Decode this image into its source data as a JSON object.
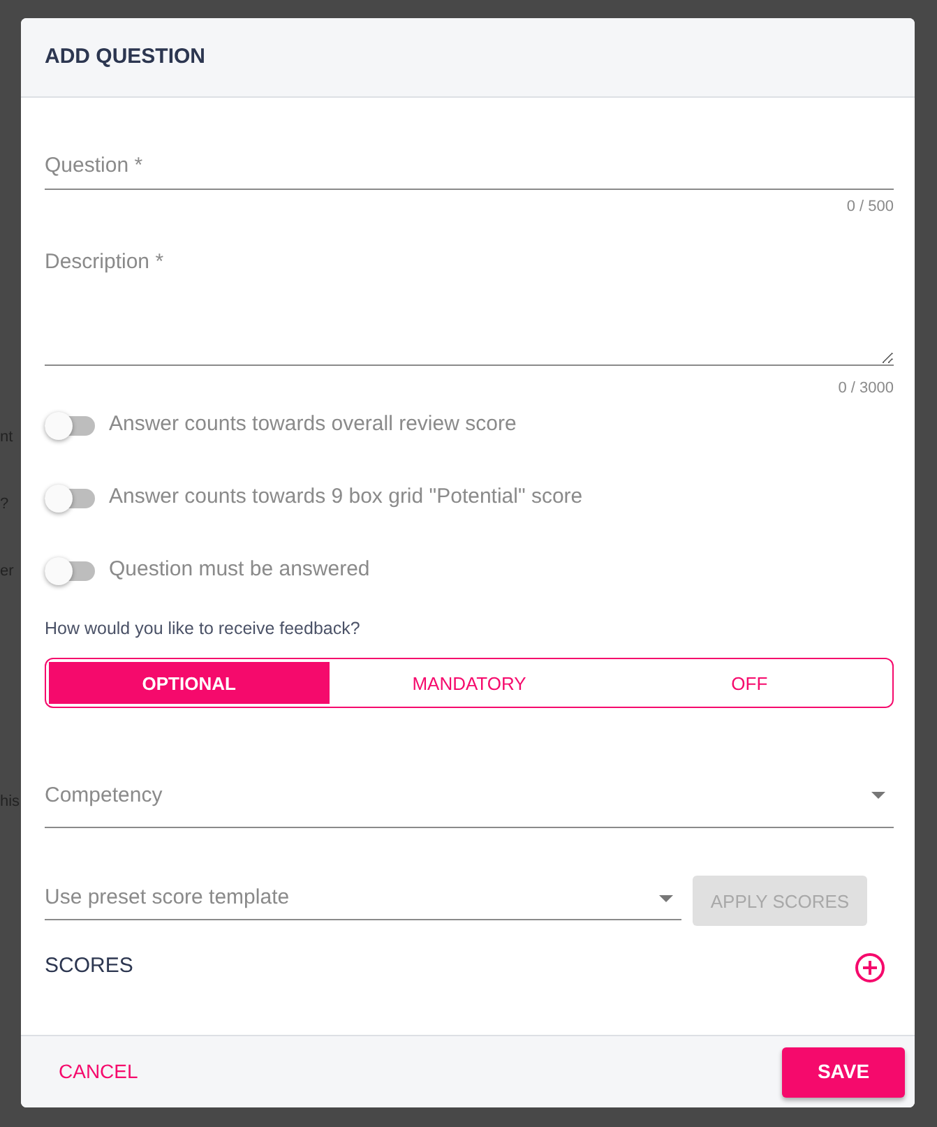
{
  "background": {
    "fragments": [
      "nt",
      "?",
      "er",
      "his"
    ]
  },
  "dialog": {
    "title": "ADD QUESTION",
    "question": {
      "placeholder": "Question *",
      "counter": "0 / 500"
    },
    "description": {
      "placeholder": "Description *",
      "counter": "0 / 3000"
    },
    "toggles": [
      {
        "label": "Answer counts towards overall review score",
        "on": false
      },
      {
        "label": "Answer counts towards 9 box grid \"Potential\" score",
        "on": false
      },
      {
        "label": "Question must be answered",
        "on": false
      }
    ],
    "feedback": {
      "prompt": "How would you like to receive feedback?",
      "options": [
        {
          "label": "OPTIONAL",
          "selected": true
        },
        {
          "label": "MANDATORY",
          "selected": false
        },
        {
          "label": "OFF",
          "selected": false
        }
      ]
    },
    "competency": {
      "placeholder": "Competency"
    },
    "template": {
      "placeholder": "Use preset score template",
      "apply_button": {
        "label": "APPLY SCORES",
        "disabled": true
      }
    },
    "scores": {
      "heading": "SCORES"
    },
    "footer": {
      "cancel": "CANCEL",
      "save": "SAVE"
    }
  }
}
